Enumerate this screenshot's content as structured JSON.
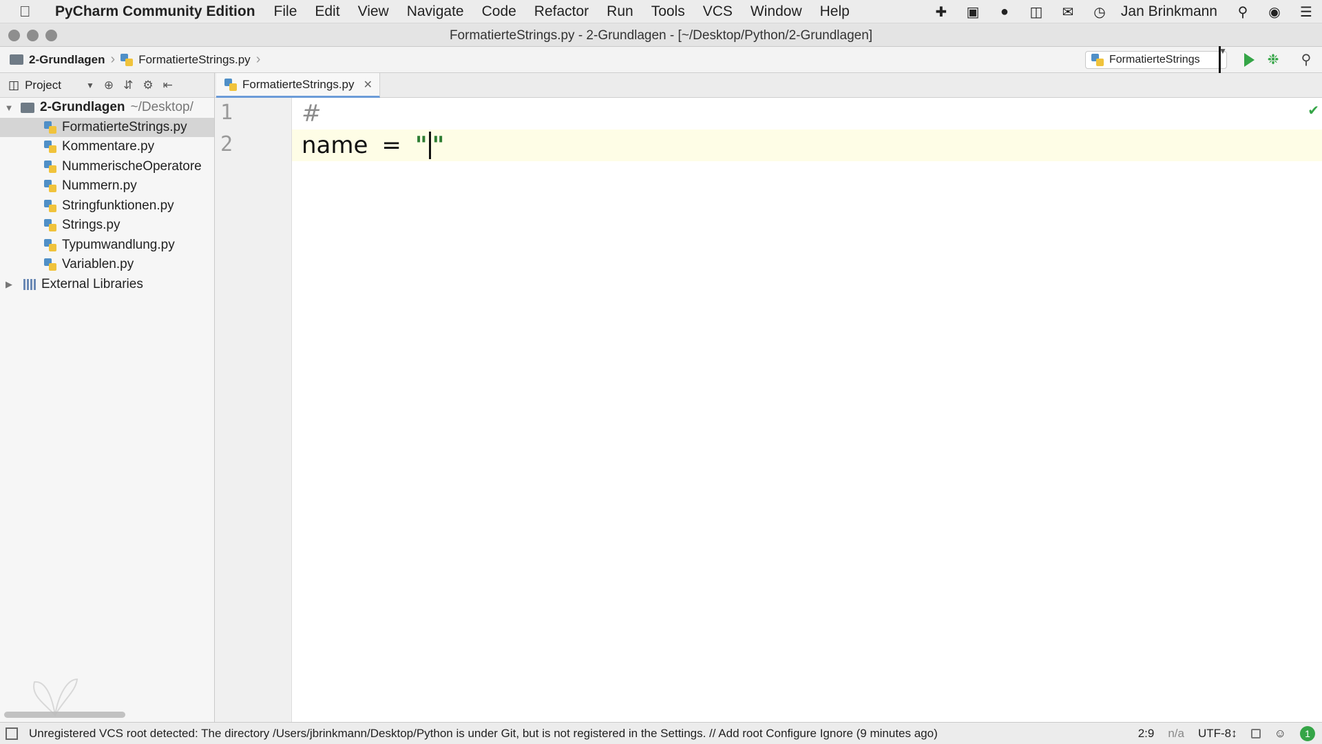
{
  "menubar": {
    "app_name": "PyCharm Community Edition",
    "items": [
      "File",
      "Edit",
      "View",
      "Navigate",
      "Code",
      "Refactor",
      "Run",
      "Tools",
      "VCS",
      "Window",
      "Help"
    ],
    "user_name": "Jan Brinkmann",
    "tray_icons": [
      "puzzle-icon",
      "media-icon",
      "leaf-icon",
      "camera-icon",
      "chat-bubble-icon",
      "time-machine-icon"
    ]
  },
  "window": {
    "title": "FormatierteStrings.py - 2-Grundlagen - [~/Desktop/Python/2-Grundlagen]"
  },
  "navbar": {
    "breadcrumb": [
      "2-Grundlagen",
      "FormatierteStrings.py"
    ],
    "run_config": "FormatierteStrings"
  },
  "project_panel": {
    "header_label": "Project",
    "root": {
      "name": "2-Grundlagen",
      "path": "~/Desktop/"
    },
    "files": [
      "FormatierteStrings.py",
      "Kommentare.py",
      "NummerischeOperatore",
      "Nummern.py",
      "Stringfunktionen.py",
      "Strings.py",
      "Typumwandlung.py",
      "Variablen.py"
    ],
    "selected_file": "FormatierteStrings.py",
    "external_libraries": "External Libraries"
  },
  "editor": {
    "tab_label": "FormatierteStrings.py",
    "line_numbers": [
      "1",
      "2"
    ],
    "line1_comment": "#",
    "line2_name": "name",
    "line2_op": "=",
    "line2_quote_open": "\"",
    "line2_quote_close": "\""
  },
  "statusbar": {
    "message": "Unregistered VCS root detected: The directory /Users/jbrinkmann/Desktop/Python is under Git, but is not registered in the Settings. // Add root  Configure  Ignore (9 minutes ago)",
    "position": "2:9",
    "na": "n/a",
    "encoding": "UTF-8↕",
    "badge": "1"
  },
  "colors": {
    "run_green": "#35a547",
    "string_green": "#2e7d32",
    "current_line": "#fefde6",
    "selection": "#d5d5d5"
  }
}
